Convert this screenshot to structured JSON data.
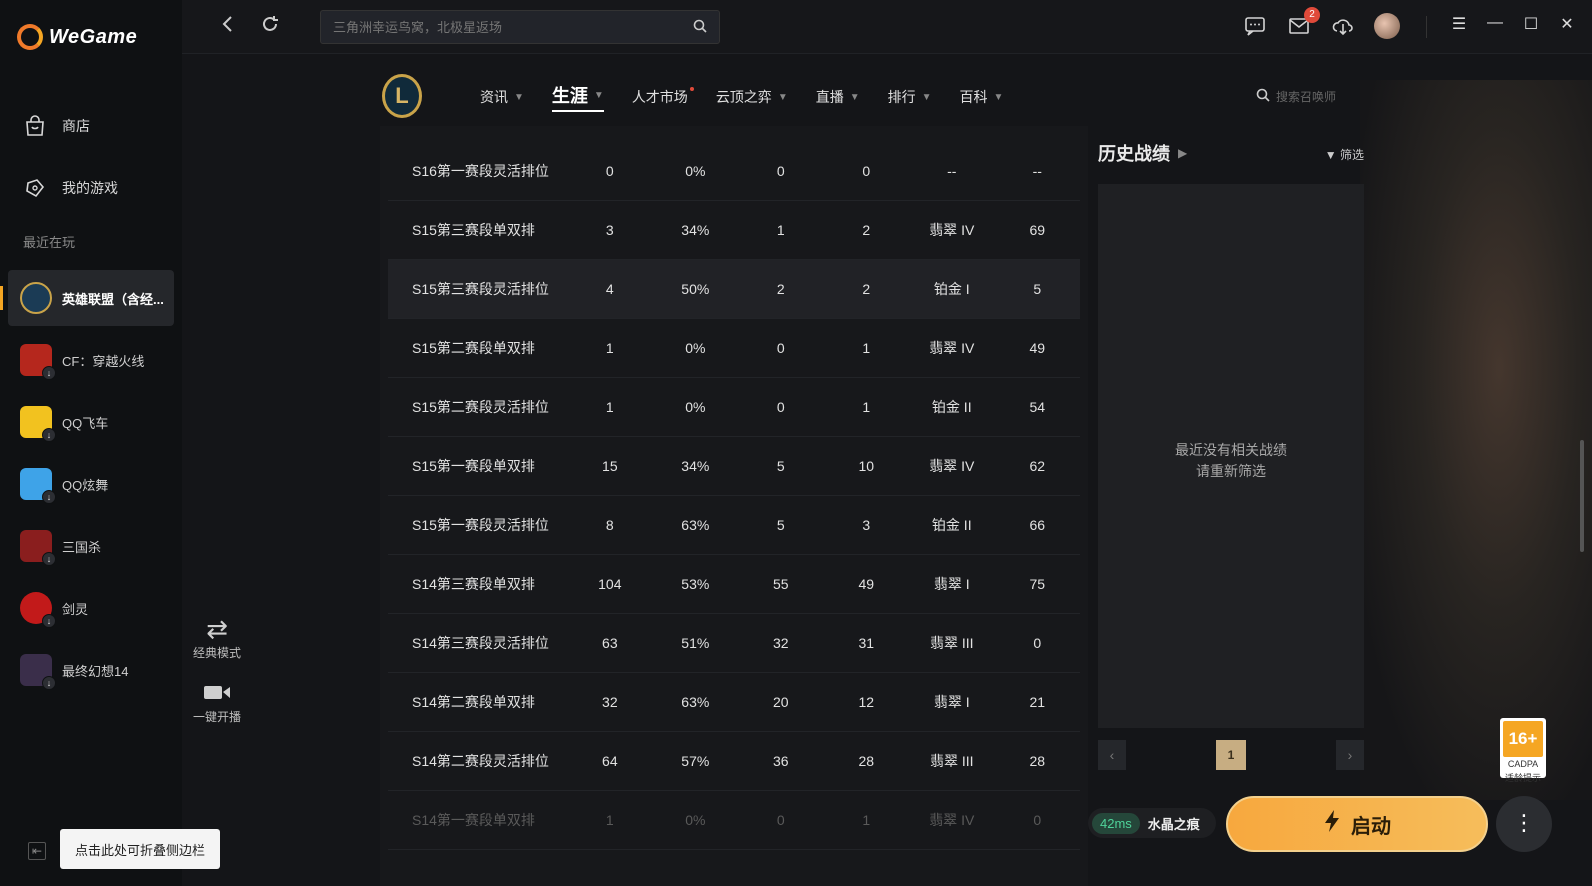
{
  "app": {
    "name": "WeGame"
  },
  "sidebar": {
    "nav": [
      {
        "label": "商店",
        "icon": "shop-bag-icon"
      },
      {
        "label": "我的游戏",
        "icon": "gamepad-icon"
      }
    ],
    "recent_title": "最近在玩",
    "games": [
      {
        "label": "英雄联盟（含经...",
        "color": "#1b3b55",
        "active": true
      },
      {
        "label": "CF：穿越火线",
        "color": "#b5271d",
        "active": false
      },
      {
        "label": "QQ飞车",
        "color": "#f2c21f",
        "active": false
      },
      {
        "label": "QQ炫舞",
        "color": "#3ea3e8",
        "active": false
      },
      {
        "label": "三国杀",
        "color": "#8a1e1e",
        "active": false
      },
      {
        "label": "剑灵",
        "color": "#c21a1a",
        "active": false
      },
      {
        "label": "最终幻想14",
        "color": "#3a2e4a",
        "active": false
      }
    ],
    "collapse_tooltip": "点击此处可折叠侧边栏"
  },
  "topbar": {
    "search_placeholder": "三角洲幸运鸟窝，北极星返场",
    "mail_badge": "2"
  },
  "game_header": {
    "tabs": [
      {
        "label": "资讯",
        "caret": true
      },
      {
        "label": "生涯",
        "caret": true,
        "active": true
      },
      {
        "label": "人才市场",
        "caret": false,
        "dot": true
      },
      {
        "label": "云顶之弈",
        "caret": true
      },
      {
        "label": "直播",
        "caret": true
      },
      {
        "label": "排行",
        "caret": true
      },
      {
        "label": "百科",
        "caret": true
      }
    ],
    "summoner_search_placeholder": "搜索召唤师"
  },
  "mode_switch": {
    "classic_label": "经典模式",
    "stream_label": "一键开播"
  },
  "season_table": {
    "rows": [
      {
        "name": "S16第一赛段灵活排位",
        "games": "0",
        "winrate": "0%",
        "wins": "0",
        "losses": "0",
        "rank": "--",
        "score": "--"
      },
      {
        "name": "S15第三赛段单双排",
        "games": "3",
        "winrate": "34%",
        "wins": "1",
        "losses": "2",
        "rank": "翡翠 IV",
        "score": "69"
      },
      {
        "name": "S15第三赛段灵活排位",
        "games": "4",
        "winrate": "50%",
        "wins": "2",
        "losses": "2",
        "rank": "铂金 I",
        "score": "5"
      },
      {
        "name": "S15第二赛段单双排",
        "games": "1",
        "winrate": "0%",
        "wins": "0",
        "losses": "1",
        "rank": "翡翠 IV",
        "score": "49"
      },
      {
        "name": "S15第二赛段灵活排位",
        "games": "1",
        "winrate": "0%",
        "wins": "0",
        "losses": "1",
        "rank": "铂金 II",
        "score": "54"
      },
      {
        "name": "S15第一赛段单双排",
        "games": "15",
        "winrate": "34%",
        "wins": "5",
        "losses": "10",
        "rank": "翡翠 IV",
        "score": "62"
      },
      {
        "name": "S15第一赛段灵活排位",
        "games": "8",
        "winrate": "63%",
        "wins": "5",
        "losses": "3",
        "rank": "铂金 II",
        "score": "66"
      },
      {
        "name": "S14第三赛段单双排",
        "games": "104",
        "winrate": "53%",
        "wins": "55",
        "losses": "49",
        "rank": "翡翠 I",
        "score": "75"
      },
      {
        "name": "S14第三赛段灵活排位",
        "games": "63",
        "winrate": "51%",
        "wins": "32",
        "losses": "31",
        "rank": "翡翠 III",
        "score": "0"
      },
      {
        "name": "S14第二赛段单双排",
        "games": "32",
        "winrate": "63%",
        "wins": "20",
        "losses": "12",
        "rank": "翡翠 I",
        "score": "21"
      },
      {
        "name": "S14第二赛段灵活排位",
        "games": "64",
        "winrate": "57%",
        "wins": "36",
        "losses": "28",
        "rank": "翡翠 III",
        "score": "28"
      },
      {
        "name": "S14第一赛段单双排",
        "games": "1",
        "winrate": "0%",
        "wins": "0",
        "losses": "1",
        "rank": "翡翠 IV",
        "score": "0"
      }
    ]
  },
  "history": {
    "title": "历史战绩",
    "filter_label": "筛选",
    "empty_line1": "最近没有相关战绩",
    "empty_line2": "请重新筛选",
    "page": "1"
  },
  "launch_bar": {
    "ping": "42ms",
    "server": "水晶之痕",
    "launch_label": "启动"
  },
  "age_rating": {
    "age": "16+",
    "org": "CADPA",
    "note": "适龄提示"
  },
  "colors": {
    "accent": "#f5a623",
    "ping_green": "#4fd39a"
  }
}
